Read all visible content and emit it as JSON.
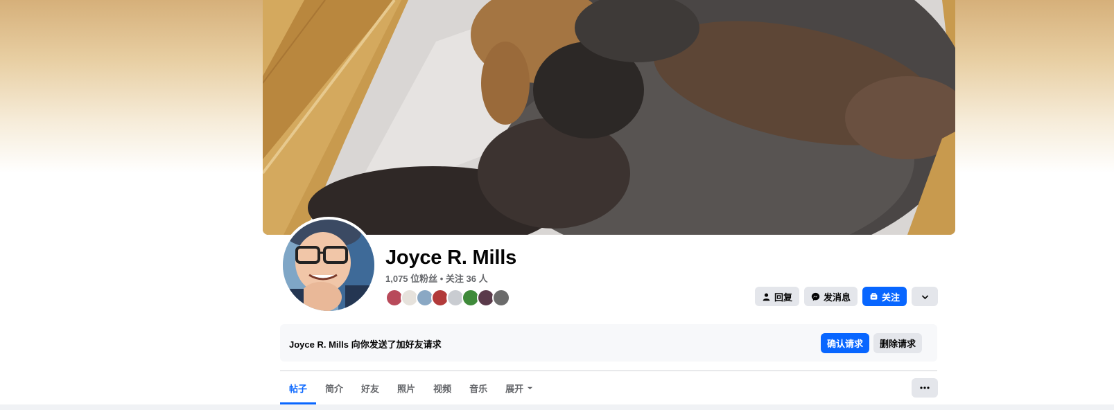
{
  "profile": {
    "name": "Joyce R. Mills",
    "stats": "1,075 位粉丝 • 关注 36 人",
    "friend_avatars": [
      {
        "color": "#b84a5a"
      },
      {
        "color": "#e6e2dc"
      },
      {
        "color": "#8aa8c4"
      },
      {
        "color": "#b23a3a"
      },
      {
        "color": "#c9ccd1"
      },
      {
        "color": "#3f8a3a"
      },
      {
        "color": "#5a3a4a"
      },
      {
        "color": "#6b6b6b"
      }
    ]
  },
  "actions": {
    "reply_label": "回复",
    "message_label": "发消息",
    "follow_label": "关注"
  },
  "friend_request": {
    "text": "Joyce R. Mills 向你发送了加好友请求",
    "confirm_label": "确认请求",
    "delete_label": "删除请求"
  },
  "tabs": [
    {
      "label": "帖子",
      "active": true
    },
    {
      "label": "简介"
    },
    {
      "label": "好友"
    },
    {
      "label": "照片"
    },
    {
      "label": "视频"
    },
    {
      "label": "音乐"
    },
    {
      "label": "展开"
    }
  ],
  "colors": {
    "accent": "#0866ff",
    "button_gray": "#e4e6eb",
    "muted_text": "#65676b"
  }
}
